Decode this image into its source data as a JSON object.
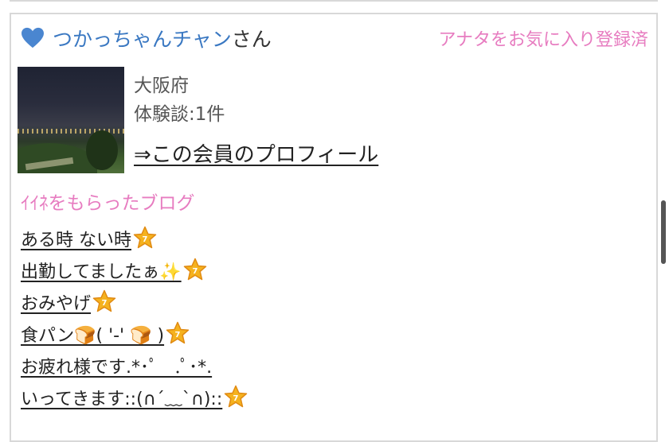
{
  "member": {
    "name": "つかっちゃんチャン",
    "suffix": "さん",
    "favorite_status": "アナタをお気に入り登録済",
    "location": "大阪府",
    "reviews": "体験談:1件",
    "profile_link": "⇒この会員のプロフィール"
  },
  "liked_blogs": {
    "title": "ｲｲﾈをもらったブログ",
    "items": [
      {
        "label": "ある時 ない時",
        "new": true
      },
      {
        "label": "出勤してましたぁ✨",
        "new": true
      },
      {
        "label": "おみやげ",
        "new": true
      },
      {
        "label": "食パン🍞( '-' 🍞 )",
        "new": true
      },
      {
        "label": "お疲れ様です.*･ﾟ　.ﾟ･*.",
        "new": false
      },
      {
        "label": "いってきます::(∩´﹏`∩)::",
        "new": true
      }
    ]
  },
  "colors": {
    "name": "#3a78c2",
    "accent_pink": "#e77cc0",
    "heart": "#4a86d0",
    "star_fill": "#f5b21e",
    "star_outline": "#e08a12"
  },
  "icons": {
    "heart": "blue-heart-icon",
    "badge": "new-star-badge-icon"
  }
}
